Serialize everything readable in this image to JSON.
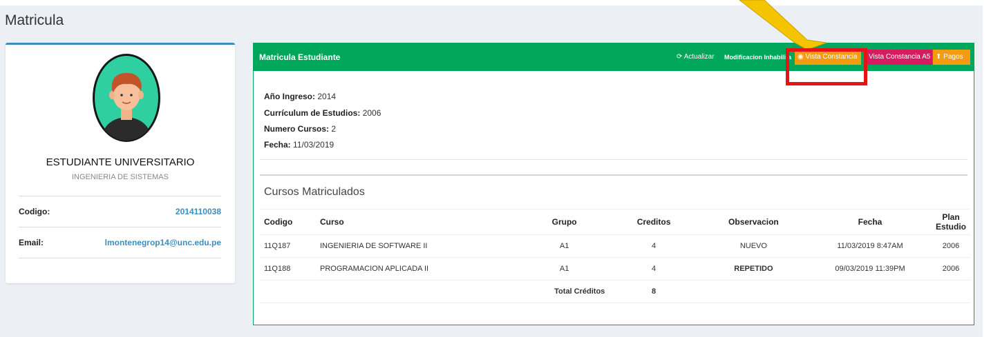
{
  "page": {
    "title": "Matricula"
  },
  "profile": {
    "name": "ESTUDIANTE UNIVERSITARIO",
    "career": "INGENIERIA DE SISTEMAS",
    "codigo_label": "Codigo:",
    "codigo_value": "2014110038",
    "email_label": "Email:",
    "email_value": "lmontenegrop14@unc.edu.pe"
  },
  "box": {
    "title": "Matricula Estudiante",
    "toolbar": {
      "actualizar": "Actualizar",
      "modificacion": "Modificacion Inhabilita",
      "vista_constancia": "Vista Constancia",
      "vista_constancia_a5": "Vista Constancia A5",
      "pagos": "Pagos"
    },
    "details": {
      "anio_label": "Año Ingreso:",
      "anio_value": "2014",
      "curriculum_label": "Currículum de Estudios:",
      "curriculum_value": "2006",
      "numero_label": "Numero Cursos:",
      "numero_value": "2",
      "fecha_label": "Fecha:",
      "fecha_value": "11/03/2019"
    },
    "cursos_title": "Cursos Matriculados",
    "table": {
      "headers": [
        "Codigo",
        "Curso",
        "Grupo",
        "Creditos",
        "Observacion",
        "Fecha",
        "Plan Estudio"
      ],
      "rows": [
        [
          "11Q187",
          "INGENIERIA DE SOFTWARE II",
          "A1",
          "4",
          "NUEVO",
          "11/03/2019 8:47AM",
          "2006"
        ],
        [
          "11Q188",
          "PROGRAMACION APLICADA II",
          "A1",
          "4",
          "REPETIDO",
          "09/03/2019 11:39PM",
          "2006"
        ]
      ],
      "total_label": "Total Créditos",
      "total_value": "8"
    }
  },
  "colors": {
    "header_green": "#00a65a",
    "button_orange": "#f39c12",
    "button_maroon": "#d81b60",
    "link_blue": "#3c8dbc",
    "highlight_red": "#e51313",
    "pointer_yellow": "#f5c400",
    "repetido_red": "#dd1c1c"
  },
  "icons": {
    "actualizar": "refresh-icon",
    "vista_constancia": "eye-icon",
    "pagos": "circle-up-icon"
  }
}
